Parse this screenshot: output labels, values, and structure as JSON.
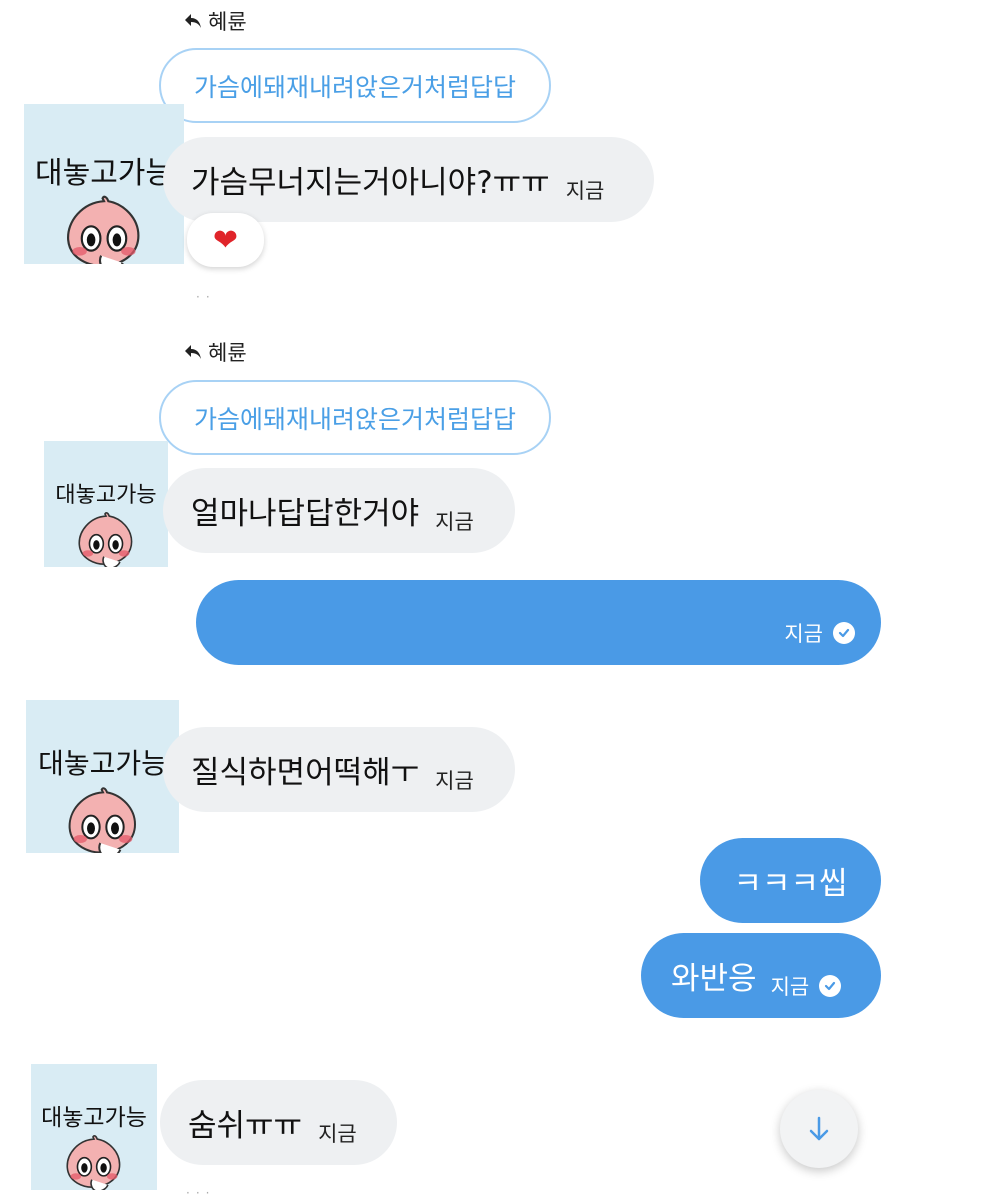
{
  "messages": [
    {
      "reply_to": "혜륜",
      "quote": "가슴에돼재내려앉은거처럼답답",
      "avatar_text": "대놓고가능",
      "text": "가슴무너지는거아니야?ㅠㅠ",
      "time": "지금",
      "reaction": "❤"
    },
    {
      "reply_to": "혜륜",
      "quote": "가슴에돼재내려앉은거처럼답답",
      "avatar_text": "대놓고가능",
      "text": "얼마나답답한거야",
      "time": "지금"
    },
    {
      "text": "",
      "time": "지금",
      "read": true
    },
    {
      "avatar_text": "대놓고가능",
      "text": "질식하면어떡해ㅜ",
      "time": "지금"
    },
    {
      "text": "ㅋㅋㅋ씹"
    },
    {
      "text": "와반응",
      "time": "지금",
      "read": true
    },
    {
      "avatar_text": "대놓고가능",
      "text": "숨쉬ㅠㅠ",
      "time": "지금"
    }
  ],
  "icons": {
    "reply": "reply-arrow-icon",
    "read": "check-circle-icon",
    "scroll_down": "arrow-down-icon",
    "avatar": "peach-character-icon"
  },
  "colors": {
    "outgoing_bubble": "#4a9ae6",
    "incoming_bubble": "#eef0f2",
    "quote_border": "#a8d2f5",
    "quote_text": "#4a9fe6",
    "avatar_bg": "#d9ecf4"
  }
}
